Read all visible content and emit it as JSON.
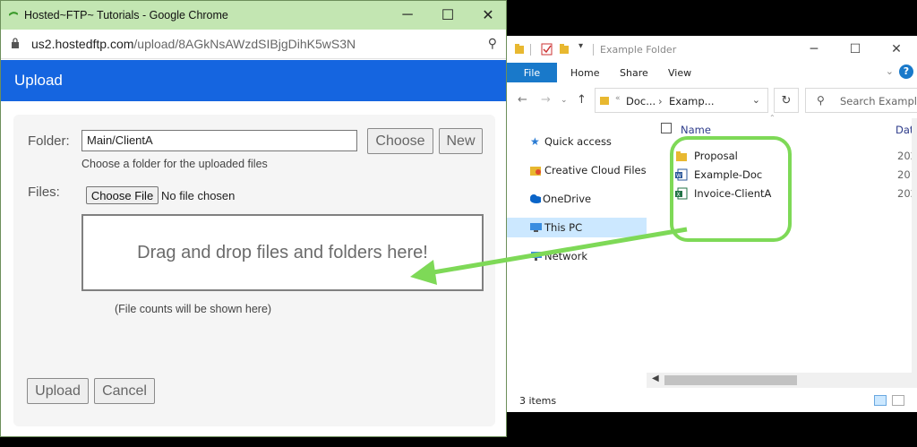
{
  "explorer": {
    "title": "Example Folder",
    "ribbon": {
      "file": "File",
      "tabs": [
        "Home",
        "Share",
        "View"
      ],
      "help": "?"
    },
    "address": {
      "crumb1": "Doc...",
      "crumb2": "Examp..."
    },
    "search_placeholder": "Search Example",
    "nav": [
      "Quick access",
      "Creative Cloud Files",
      "OneDrive",
      "This PC",
      "Network"
    ],
    "columns": {
      "name": "Name",
      "date": "Date"
    },
    "files": [
      {
        "name": "Proposal",
        "type": "folder",
        "date": "202"
      },
      {
        "name": "Example-Doc",
        "type": "word",
        "date": "201"
      },
      {
        "name": "Invoice-ClientA",
        "type": "excel",
        "date": "202"
      }
    ],
    "status": "3 items"
  },
  "chrome": {
    "title": "Hosted~FTP~ Tutorials - Google Chrome",
    "url_host": "us2.hostedftp.com",
    "url_path": "/upload/8AGkNsAWzdSIBjgDihK5wS3N"
  },
  "upload": {
    "header": "Upload",
    "folder_label": "Folder:",
    "folder_value": "Main/ClientA",
    "choose_label": "Choose",
    "new_label": "New",
    "folder_hint": "Choose a folder for the uploaded files",
    "files_label": "Files:",
    "choose_file_label": "Choose File",
    "no_file_text": "No file chosen",
    "dropzone_text": "Drag and drop files and folders here!",
    "counts_text": "(File counts will be shown here)",
    "upload_label": "Upload",
    "cancel_label": "Cancel"
  },
  "colors": {
    "chrome_title_bg": "#c3e6b2",
    "upload_header_bg": "#1565e0",
    "highlight_green": "#7ed957",
    "ribbon_blue": "#1979ca"
  }
}
